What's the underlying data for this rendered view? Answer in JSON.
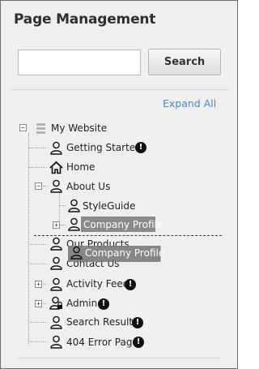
{
  "panel": {
    "title": "Page Management",
    "search": {
      "placeholder": "",
      "value": "",
      "button_label": "Search"
    },
    "expand_all_label": "Expand All"
  },
  "tree": {
    "root": {
      "label": "My Website"
    },
    "nodes": [
      {
        "label": "Getting Started",
        "icon": "user-page-icon",
        "warning": true
      },
      {
        "label": "Home",
        "icon": "home-icon",
        "warning": false
      },
      {
        "label": "About Us",
        "icon": "user-page-icon",
        "warning": false,
        "expanded": true
      },
      {
        "label": "StyleGuide",
        "icon": "user-page-icon",
        "warning": false
      },
      {
        "label": "Company Profile",
        "icon": "user-page-icon",
        "warning": false,
        "selected": true
      },
      {
        "label": "Our Products",
        "icon": "user-page-icon",
        "warning": false
      },
      {
        "label": "Contact Us",
        "icon": "user-page-icon",
        "warning": false
      },
      {
        "label": "Activity Feed",
        "icon": "user-page-icon",
        "warning": true
      },
      {
        "label": "Admin",
        "icon": "locked-user-page-icon",
        "warning": true
      },
      {
        "label": "Search Results",
        "icon": "user-page-icon",
        "warning": true
      },
      {
        "label": "404 Error Page",
        "icon": "user-page-icon",
        "warning": true
      }
    ],
    "drag_ghost_label": "Company Profile",
    "warning_glyph": "!"
  },
  "colors": {
    "accent_link": "#4b8bbd",
    "selected_bg": "#8a8a8a",
    "panel_bg": "#efefef"
  }
}
